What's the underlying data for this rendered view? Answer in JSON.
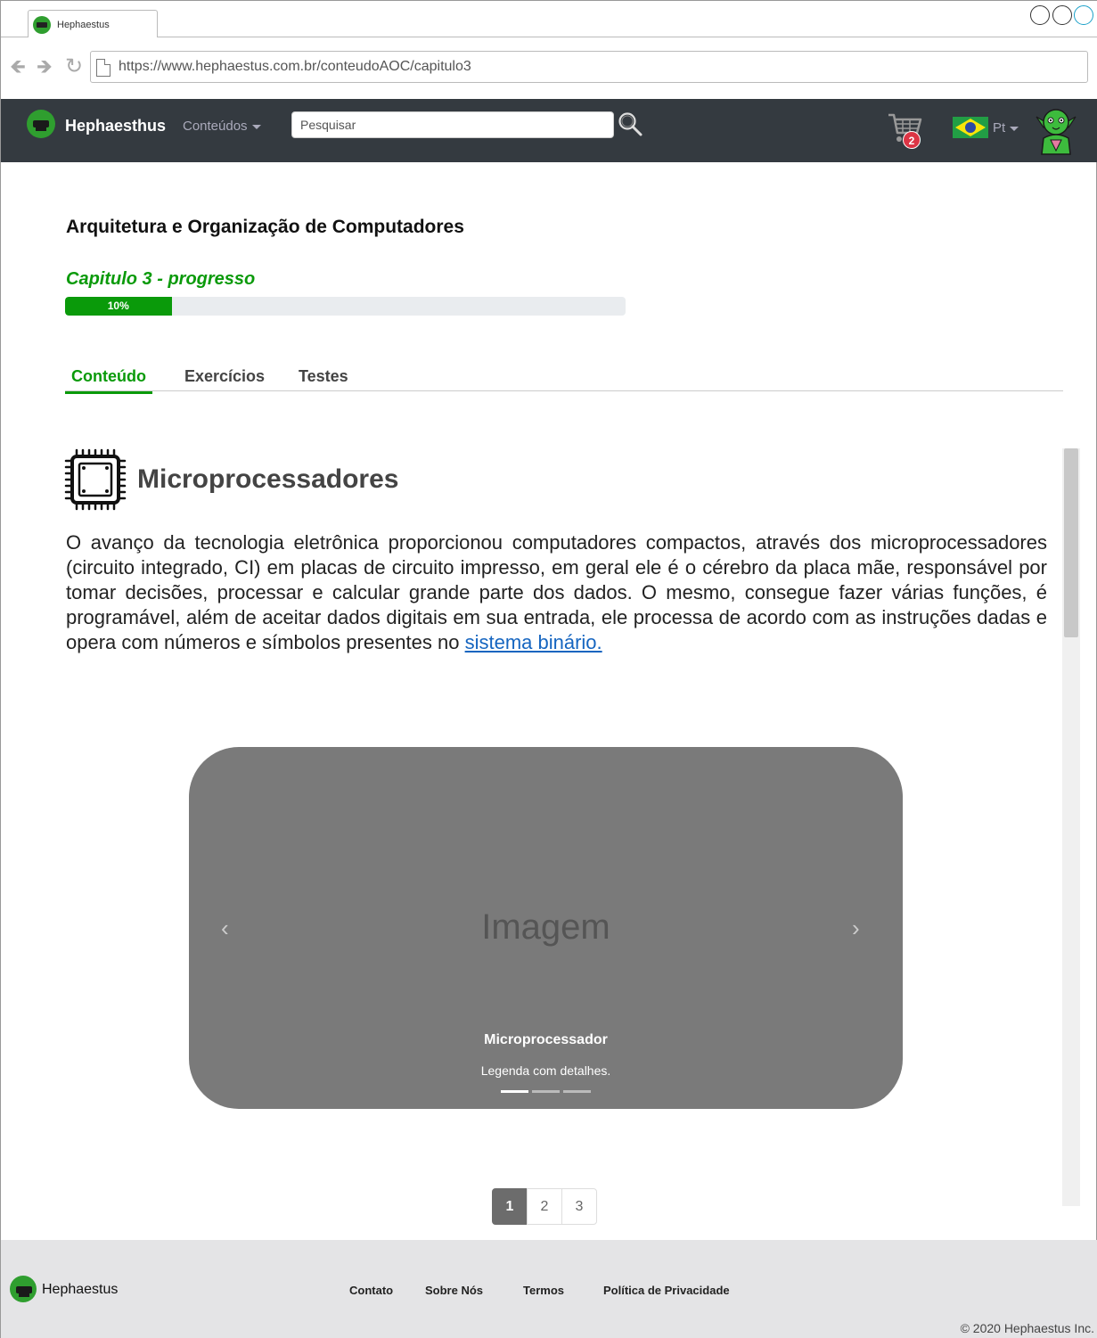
{
  "browser": {
    "tab_title": "Hephaestus",
    "url": "https://www.hephaestus.com.br/conteudoAOC/capitulo3"
  },
  "navbar": {
    "brand": "Hephaesthus",
    "menu_label": "Conteúdos",
    "search_placeholder": "Pesquisar",
    "cart_count": "2",
    "language": "Pt"
  },
  "course": {
    "title": "Arquitetura e Organização de Computadores",
    "progress_label": "Capitulo 3 - progresso",
    "progress_text": "10%",
    "progress_value": 0.1
  },
  "tabs": [
    {
      "label": "Conteúdo",
      "active": true
    },
    {
      "label": "Exercícios",
      "active": false
    },
    {
      "label": "Testes",
      "active": false
    }
  ],
  "section": {
    "title": "Microprocessadores",
    "paragraph": "O avanço da tecnologia eletrônica proporcionou computadores compactos, através dos microprocessadores (circuito integrado, CI) em placas de circuito impresso, em geral ele é o cérebro da placa mãe, responsável por tomar decisões, processar e calcular grande parte dos dados. O mesmo, consegue fazer várias funções, é programável, além de aceitar dados digitais em sua entrada, ele processa de acordo com as instruções dadas e opera com números e símbolos presentes no",
    "link_text": "sistema binário."
  },
  "carousel": {
    "image_text": "Imagem",
    "caption": "Microprocessador",
    "legend": "Legenda com detalhes.",
    "prev_glyph": "‹",
    "next_glyph": "›",
    "active_slide": 1
  },
  "pagination": [
    "1",
    "2",
    "3"
  ],
  "footer": {
    "brand": "Hephaestus",
    "links": [
      "Contato",
      "Sobre Nós",
      "Termos",
      "Política de Privacidade"
    ],
    "copyright": "© 2020 Hephaestus Inc."
  },
  "colors": {
    "navbar_bg": "#343a40",
    "accent_green": "#0a9a0a",
    "badge_red": "#dc3545",
    "link_blue": "#1565c0",
    "carousel_bg": "#7a7a7a",
    "footer_bg": "#e4e4e6"
  }
}
